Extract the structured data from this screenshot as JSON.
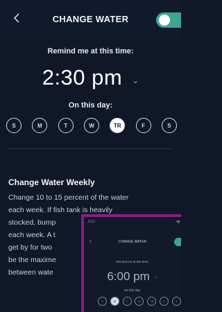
{
  "header": {
    "title": "CHANGE WATER",
    "back_icon": "chevron-left-icon",
    "toggle_on": true
  },
  "reminder": {
    "label": "Remind me at this time:",
    "time": "2:30 pm",
    "dropdown_icon": "chevron-down-icon",
    "day_label": "On this day:",
    "days": [
      {
        "letter": "S",
        "active": false
      },
      {
        "letter": "M",
        "active": false
      },
      {
        "letter": "T",
        "active": false
      },
      {
        "letter": "W",
        "active": false
      },
      {
        "letter": "TR",
        "active": true
      },
      {
        "letter": "F",
        "active": false
      },
      {
        "letter": "S",
        "active": false
      }
    ]
  },
  "info": {
    "title": "Change Water Weekly",
    "lines": [
      "Change 10 to 15 percent of the water",
      "each week. If fish tank is heavily",
      "stocked, bump",
      "each week. A t",
      "get by for two",
      "be the maxime",
      "between wate"
    ]
  },
  "thumbnail": {
    "status_time": "9:12",
    "title": "CHANGE WATER",
    "remind_label": "Remind me at this time:",
    "time": "6:00 pm",
    "day_label": "On this day:",
    "days": [
      {
        "letter": "S",
        "active": false
      },
      {
        "letter": "M",
        "active": true
      },
      {
        "letter": "T",
        "active": false
      },
      {
        "letter": "W",
        "active": false
      },
      {
        "letter": "TR",
        "active": false
      },
      {
        "letter": "F",
        "active": false
      },
      {
        "letter": "S",
        "active": false
      }
    ]
  },
  "colors": {
    "background": "#101828",
    "toggle_accent": "#3fa58f",
    "thumbnail_border": "#8b1d83"
  }
}
